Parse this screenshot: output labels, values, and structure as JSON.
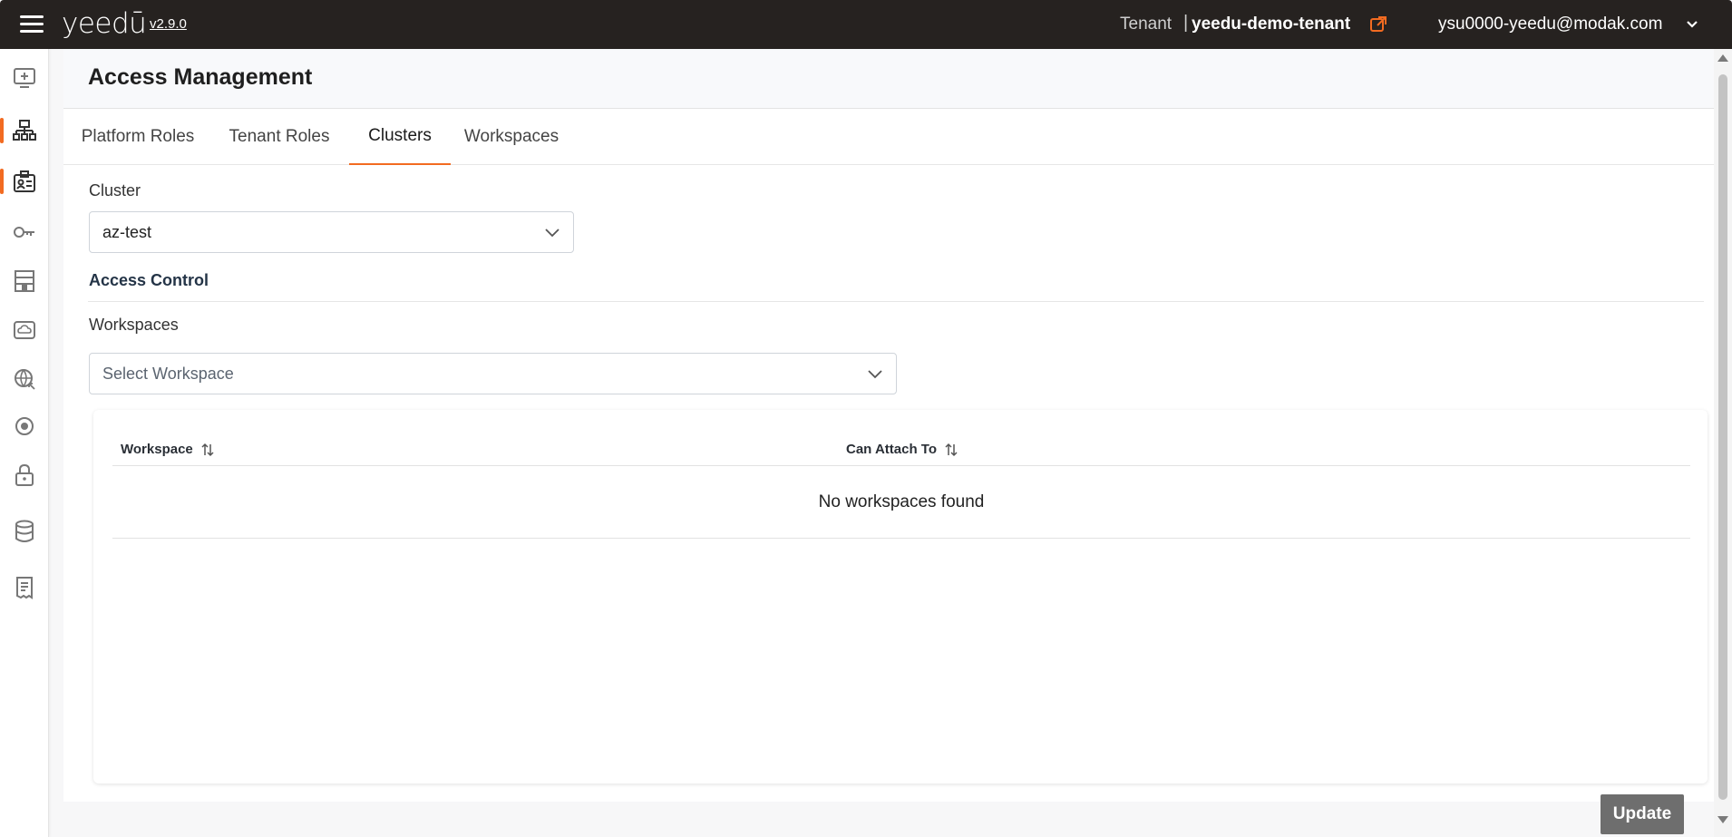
{
  "app": {
    "logo": "yeedū",
    "version": "v2.9.0"
  },
  "header": {
    "tenant_label": "Tenant",
    "tenant_separator": "|",
    "tenant_name": "yeedu-demo-tenant",
    "user_email": "ysu0000-yeedu@modak.com"
  },
  "sidebar": {
    "items": [
      {
        "icon": "add-monitor-icon"
      },
      {
        "icon": "org-hierarchy-icon",
        "active": true
      },
      {
        "icon": "id-card-icon",
        "active": true
      },
      {
        "icon": "key-icon"
      },
      {
        "icon": "building-icon"
      },
      {
        "icon": "cloud-storage-icon"
      },
      {
        "icon": "globe-network-icon"
      },
      {
        "icon": "target-icon"
      },
      {
        "icon": "lock-icon"
      },
      {
        "icon": "database-icon"
      },
      {
        "icon": "receipt-icon"
      }
    ]
  },
  "page": {
    "title": "Access Management",
    "tabs": [
      {
        "label": "Platform Roles"
      },
      {
        "label": "Tenant Roles"
      },
      {
        "label": "Clusters",
        "active": true
      },
      {
        "label": "Workspaces"
      }
    ]
  },
  "form": {
    "cluster_label": "Cluster",
    "cluster_value": "az-test",
    "access_control_title": "Access Control",
    "workspaces_label": "Workspaces",
    "workspace_placeholder": "Select Workspace"
  },
  "table": {
    "columns": [
      "Workspace",
      "Can Attach To"
    ],
    "empty_message": "No workspaces found"
  },
  "actions": {
    "update_label": "Update"
  },
  "colors": {
    "accent": "#f26b21",
    "topbar": "#262220",
    "button_disabled": "#6e6e6e"
  }
}
